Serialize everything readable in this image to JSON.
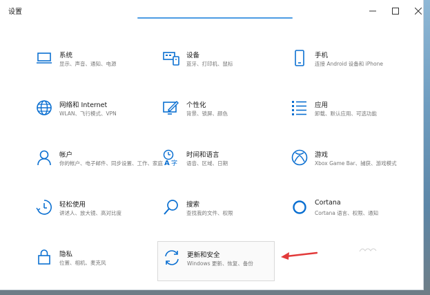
{
  "window": {
    "title": "设置"
  },
  "items": [
    {
      "name": "系统",
      "desc": "显示、声音、通知、电源",
      "icon": "laptop-icon"
    },
    {
      "name": "设备",
      "desc": "蓝牙、打印机、鼠标",
      "icon": "devices-icon"
    },
    {
      "name": "手机",
      "desc": "连接 Android 设备和 iPhone",
      "icon": "phone-icon"
    },
    {
      "name": "网络和 Internet",
      "desc": "WLAN、飞行模式、VPN",
      "icon": "globe-icon"
    },
    {
      "name": "个性化",
      "desc": "背景、锁屏、颜色",
      "icon": "personalization-icon"
    },
    {
      "name": "应用",
      "desc": "卸载、默认应用、可选功能",
      "icon": "apps-list-icon"
    },
    {
      "name": "帐户",
      "desc": "你的帐户、电子邮件、同步设置、工作、家庭",
      "icon": "account-person-icon"
    },
    {
      "name": "时间和语言",
      "desc": "语音、区域、日期",
      "icon": "time-language-icon"
    },
    {
      "name": "游戏",
      "desc": "Xbox Game Bar、捕获、游戏模式",
      "icon": "xbox-icon"
    },
    {
      "name": "轻松使用",
      "desc": "讲述人、放大镜、高对比度",
      "icon": "ease-of-access-icon"
    },
    {
      "name": "搜索",
      "desc": "查找我的文件、权限",
      "icon": "search-icon"
    },
    {
      "name": "Cortana",
      "desc": "Cortana 语言、权限、通知",
      "icon": "cortana-ring-icon"
    },
    {
      "name": "隐私",
      "desc": "位置、相机、麦克风",
      "icon": "lock-icon"
    },
    {
      "name": "更新和安全",
      "desc": "Windows 更新、恢复、备份",
      "icon": "update-sync-icon"
    }
  ],
  "colors": {
    "accent": "#0a6fd1",
    "arrow": "#e23a3a"
  }
}
